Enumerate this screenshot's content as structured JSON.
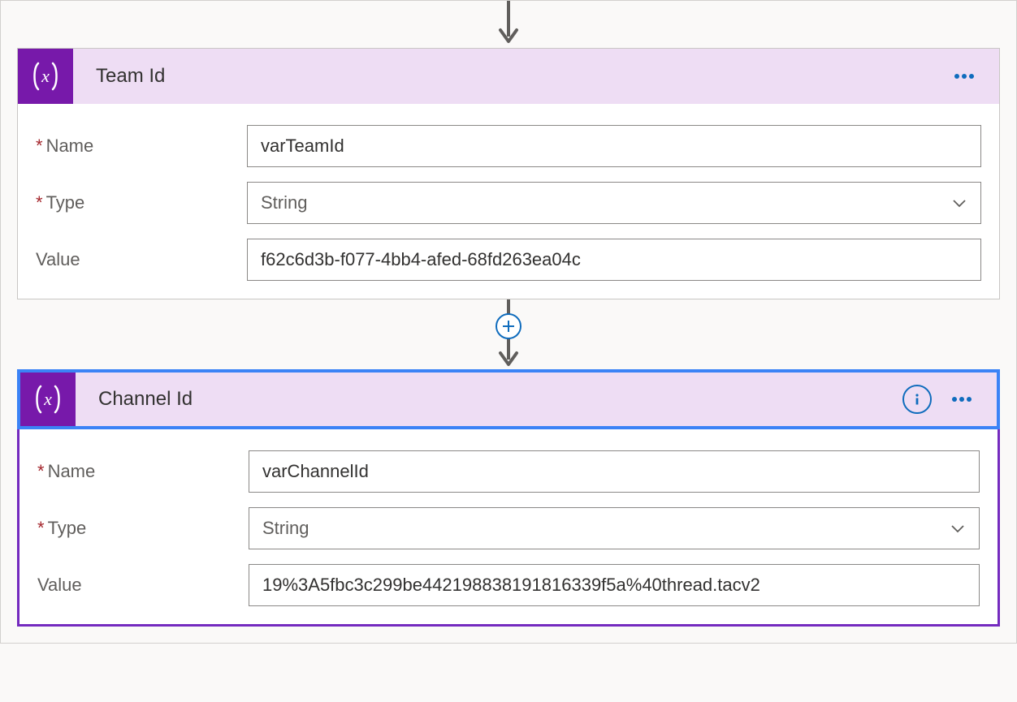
{
  "labels": {
    "name": "Name",
    "type": "Type",
    "value": "Value"
  },
  "cards": {
    "team": {
      "title": "Team Id",
      "name": "varTeamId",
      "type": "String",
      "value": "f62c6d3b-f077-4bb4-afed-68fd263ea04c"
    },
    "channel": {
      "title": "Channel Id",
      "name": "varChannelId",
      "type": "String",
      "value": "19%3A5fbc3c299be442198838191816339f5a%40thread.tacv2"
    }
  }
}
